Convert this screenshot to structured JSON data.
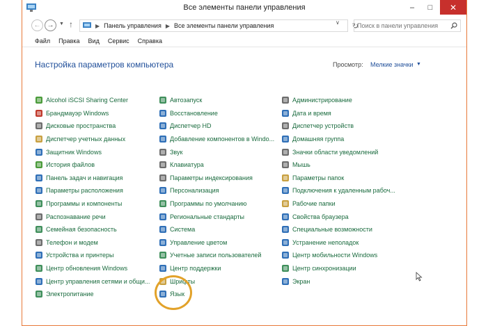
{
  "window": {
    "title": "Все элементы панели управления",
    "controls": {
      "minimize": "–",
      "maximize": "□",
      "close": "✕"
    }
  },
  "nav": {
    "breadcrumbs": [
      "Панель управления",
      "Все элементы панели управления"
    ],
    "search_placeholder": "Поиск в панели управления"
  },
  "menu": [
    "Файл",
    "Правка",
    "Вид",
    "Сервис",
    "Справка"
  ],
  "header": {
    "title": "Настройка параметров компьютера",
    "view_label": "Просмотр:",
    "view_value": "Мелкие значки"
  },
  "columns": [
    [
      {
        "label": "Alcohol iSCSI Sharing Center",
        "icon": "green-circle-icon",
        "color": "#4a9b3a"
      },
      {
        "label": "Брандмауэр Windows",
        "icon": "firewall-icon",
        "color": "#c0392b"
      },
      {
        "label": "Дисковые пространства",
        "icon": "disk-icon",
        "color": "#6d6d6d"
      },
      {
        "label": "Диспетчер учетных данных",
        "icon": "vault-icon",
        "color": "#c8a040"
      },
      {
        "label": "Защитник Windows",
        "icon": "shield-icon",
        "color": "#2f6fb7"
      },
      {
        "label": "История файлов",
        "icon": "history-icon",
        "color": "#4a9b3a"
      },
      {
        "label": "Панель задач и навигация",
        "icon": "taskbar-icon",
        "color": "#2f6fb7"
      },
      {
        "label": "Параметры расположения",
        "icon": "location-icon",
        "color": "#2f6fb7"
      },
      {
        "label": "Программы и компоненты",
        "icon": "programs-icon",
        "color": "#3f8f5b"
      },
      {
        "label": "Распознавание речи",
        "icon": "microphone-icon",
        "color": "#6d6d6d"
      },
      {
        "label": "Семейная безопасность",
        "icon": "family-icon",
        "color": "#3f8f5b"
      },
      {
        "label": "Телефон и модем",
        "icon": "phone-icon",
        "color": "#6d6d6d"
      },
      {
        "label": "Устройства и принтеры",
        "icon": "printer-icon",
        "color": "#2f6fb7"
      },
      {
        "label": "Центр обновления Windows",
        "icon": "update-icon",
        "color": "#3f8f5b"
      },
      {
        "label": "Центр управления сетями и общи...",
        "icon": "network-icon",
        "color": "#2f6fb7"
      },
      {
        "label": "Электропитание",
        "icon": "power-icon",
        "color": "#3f8f5b"
      }
    ],
    [
      {
        "label": "Автозапуск",
        "icon": "autoplay-icon",
        "color": "#3f8f5b"
      },
      {
        "label": "Восстановление",
        "icon": "recovery-icon",
        "color": "#2f6fb7"
      },
      {
        "label": "Диспетчер HD",
        "icon": "hd-icon",
        "color": "#2f6fb7"
      },
      {
        "label": "Добавление компонентов в Windo...",
        "icon": "add-features-icon",
        "color": "#2f6fb7"
      },
      {
        "label": "Звук",
        "icon": "speaker-icon",
        "color": "#6d6d6d"
      },
      {
        "label": "Клавиатура",
        "icon": "keyboard-icon",
        "color": "#6d6d6d"
      },
      {
        "label": "Параметры индексирования",
        "icon": "indexing-icon",
        "color": "#6d6d6d"
      },
      {
        "label": "Персонализация",
        "icon": "personalization-icon",
        "color": "#2f6fb7"
      },
      {
        "label": "Программы по умолчанию",
        "icon": "default-programs-icon",
        "color": "#3f8f5b"
      },
      {
        "label": "Региональные стандарты",
        "icon": "region-icon",
        "color": "#2f6fb7"
      },
      {
        "label": "Система",
        "icon": "system-icon",
        "color": "#2f6fb7"
      },
      {
        "label": "Управление цветом",
        "icon": "color-management-icon",
        "color": "#2f6fb7"
      },
      {
        "label": "Учетные записи пользователей",
        "icon": "users-icon",
        "color": "#3f8f5b"
      },
      {
        "label": "Центр поддержки",
        "icon": "flag-icon",
        "color": "#2f6fb7"
      },
      {
        "label": "Шрифты",
        "icon": "fonts-icon",
        "color": "#c8a040"
      },
      {
        "label": "Язык",
        "icon": "language-icon",
        "color": "#2f6fb7"
      }
    ],
    [
      {
        "label": "Администрирование",
        "icon": "admin-tools-icon",
        "color": "#6d6d6d"
      },
      {
        "label": "Дата и время",
        "icon": "clock-icon",
        "color": "#2f6fb7"
      },
      {
        "label": "Диспетчер устройств",
        "icon": "device-manager-icon",
        "color": "#6d6d6d"
      },
      {
        "label": "Домашняя группа",
        "icon": "homegroup-icon",
        "color": "#2f6fb7"
      },
      {
        "label": "Значки области уведомлений",
        "icon": "notification-icon",
        "color": "#6d6d6d"
      },
      {
        "label": "Мышь",
        "icon": "mouse-icon",
        "color": "#6d6d6d"
      },
      {
        "label": "Параметры папок",
        "icon": "folder-options-icon",
        "color": "#c8a040"
      },
      {
        "label": "Подключения к удаленным рабоч...",
        "icon": "remote-desktop-icon",
        "color": "#2f6fb7"
      },
      {
        "label": "Рабочие папки",
        "icon": "work-folders-icon",
        "color": "#c8a040"
      },
      {
        "label": "Свойства браузера",
        "icon": "internet-options-icon",
        "color": "#2f6fb7"
      },
      {
        "label": "Специальные возможности",
        "icon": "accessibility-icon",
        "color": "#2f6fb7"
      },
      {
        "label": "Устранение неполадок",
        "icon": "troubleshoot-icon",
        "color": "#2f6fb7"
      },
      {
        "label": "Центр мобильности Windows",
        "icon": "mobility-icon",
        "color": "#2f6fb7"
      },
      {
        "label": "Центр синхронизации",
        "icon": "sync-icon",
        "color": "#3f8f5b"
      },
      {
        "label": "Экран",
        "icon": "display-icon",
        "color": "#2f6fb7"
      }
    ]
  ],
  "colors": {
    "link": "#1a6b3e",
    "heading": "#1f4e99",
    "close_button": "#c7302c",
    "window_border": "#e87838",
    "highlight": "#e2a22a"
  }
}
